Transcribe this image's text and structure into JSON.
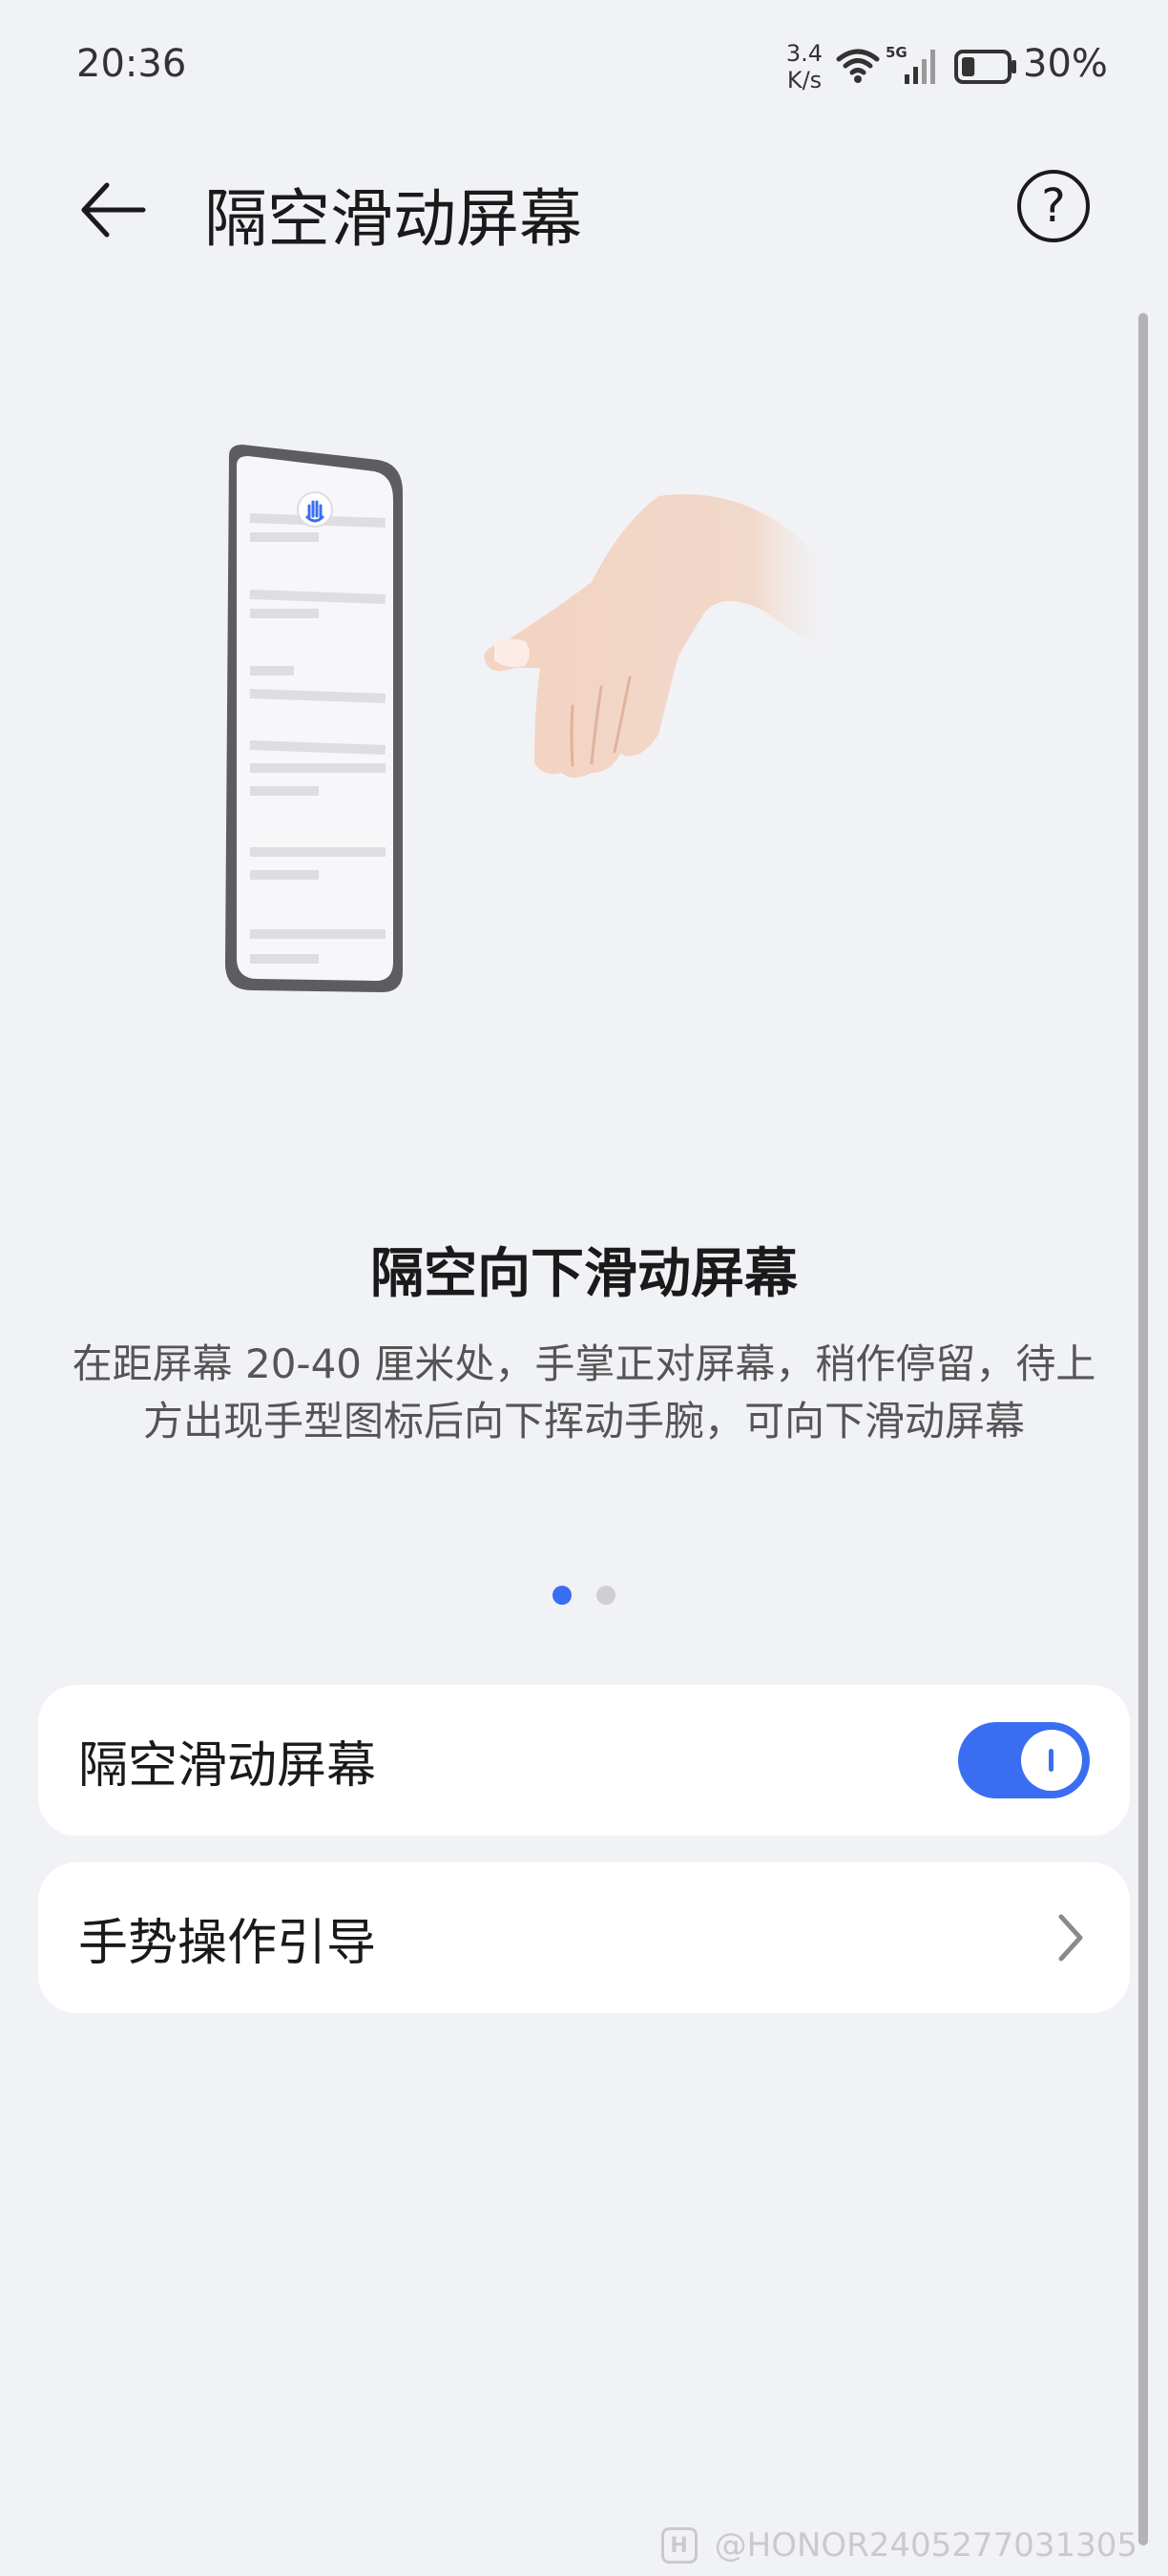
{
  "status_bar": {
    "time": "20:36",
    "net_speed_value": "3.4",
    "net_speed_unit": "K/s",
    "network_type": "5G",
    "battery_percent": "30%",
    "battery_level": 0.3
  },
  "header": {
    "title": "隔空滑动屏幕",
    "back_icon": "arrow-left-icon",
    "help_label": "?"
  },
  "illustration": {
    "icon": "hand-icon",
    "pages_total": 2,
    "current_page": 1
  },
  "slide": {
    "title": "隔空向下滑动屏幕",
    "description": "在距屏幕 20-40 厘米处，手掌正对屏幕，稍作停留，待上方出现手型图标后向下挥动手腕，可向下滑动屏幕"
  },
  "settings": {
    "toggle_item": {
      "label": "隔空滑动屏幕",
      "enabled": true
    },
    "guide_item": {
      "label": "手势操作引导",
      "icon": "chevron-right-icon"
    }
  },
  "watermark": {
    "logo_text": "H",
    "text": "@HONOR2405277031305"
  },
  "colors": {
    "accent": "#3a6ef2",
    "background": "#f1f2f6",
    "card": "#ffffff"
  }
}
